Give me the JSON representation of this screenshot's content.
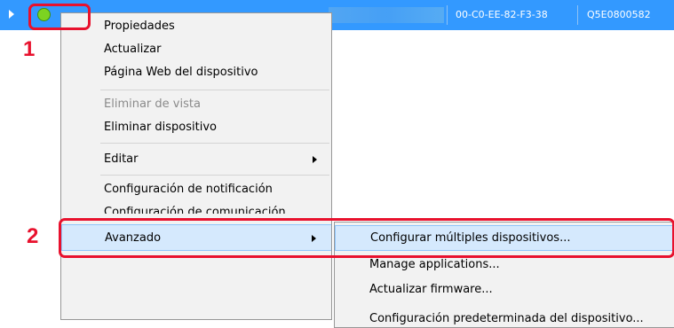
{
  "device_row": {
    "mac_address": "00-C0-EE-82-F3-38",
    "serial": "Q5E0800582",
    "status_color": "#7cd321"
  },
  "context_menu": {
    "items": [
      {
        "label": "Propiedades"
      },
      {
        "label": "Actualizar"
      },
      {
        "label": "Página Web del dispositivo"
      },
      {
        "label": "Eliminar de vista"
      },
      {
        "label": "Eliminar dispositivo"
      },
      {
        "label": "Editar"
      },
      {
        "label": "Configuración de notificación"
      },
      {
        "label": "Configuración de comunicación"
      },
      {
        "label": "Avanzado"
      }
    ]
  },
  "submenu": {
    "items": [
      {
        "label": "Configurar múltiples dispositivos..."
      },
      {
        "label": "Manage applications..."
      },
      {
        "label": "Actualizar firmware..."
      },
      {
        "label": "Configuración predeterminada del dispositivo..."
      }
    ]
  },
  "annotations": {
    "step1": "1",
    "step2": "2",
    "highlight_color": "#e8112d"
  }
}
